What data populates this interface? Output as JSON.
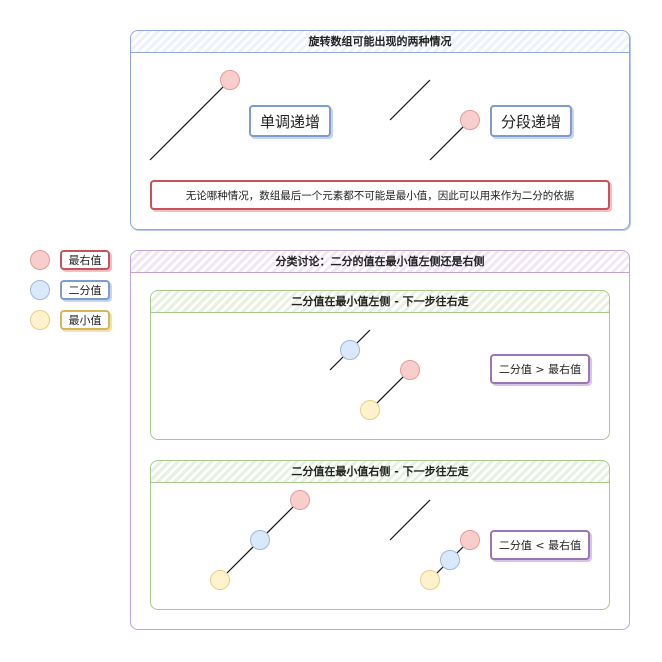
{
  "top_panel": {
    "title": "旋转数组可能出现的两种情况",
    "case_monotonic": "单调递增",
    "case_segmented": "分段递增",
    "note": "无论哪种情况，数组最后一个元素都不可能是最小值，因此可以用来作为二分的依据"
  },
  "legend": [
    {
      "label": "最右值",
      "color": "#f8cecc"
    },
    {
      "label": "二分值",
      "color": "#dae8fc"
    },
    {
      "label": "最小值",
      "color": "#fff2cc"
    }
  ],
  "bottom_panel": {
    "title": "分类讨论：二分的值在最小值左侧还是右侧",
    "left_case": {
      "title": "二分值在最小值左侧 - 下一步往右走",
      "condition": "二分值 > 最右值"
    },
    "right_case": {
      "title": "二分值在最小值右侧 - 下一步往左走",
      "condition": "二分值 < 最右值"
    }
  },
  "colors": {
    "rightmost": "#f8cecc",
    "mid": "#dae8fc",
    "min": "#fff2cc",
    "blue_border": "#8fa8d6",
    "purple_border": "#c4a3d6",
    "green_border": "#a6c98e"
  }
}
